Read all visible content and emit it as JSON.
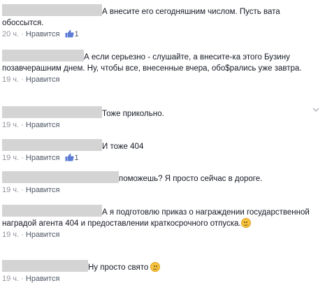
{
  "like_label": "Нравится",
  "comments": [
    {
      "text": "А внесите его сегодняшним числом. Пусть вата обоссытся.",
      "time": "20 ч.",
      "likes": "1"
    },
    {
      "text": "А если серьезно - слушайте, а внесите-ка этого Бузину позавчерашним днем. Ну, чтобы все, внесенные вчера, обо$рались уже завтра.",
      "time": "19 ч."
    },
    {
      "text": "Тоже прикольно.",
      "time": "19 ч."
    },
    {
      "text": "И тоже 404",
      "time": "19 ч.",
      "likes": "1"
    },
    {
      "text": "поможешь? Я просто сейчас в дороге.",
      "time": "19 ч."
    },
    {
      "text": "А я подготовлю приказ о награждении государственной наградой агента 404 и предоставлении краткосрочного отпуска.",
      "time": "19 ч."
    },
    {
      "text": "Ну просто свято",
      "time": "19 ч."
    }
  ],
  "colors": {
    "link": "#4e5665",
    "meta": "#90949c",
    "like_blue": "#5b7bd5",
    "redacted": "#d4d4d4"
  }
}
